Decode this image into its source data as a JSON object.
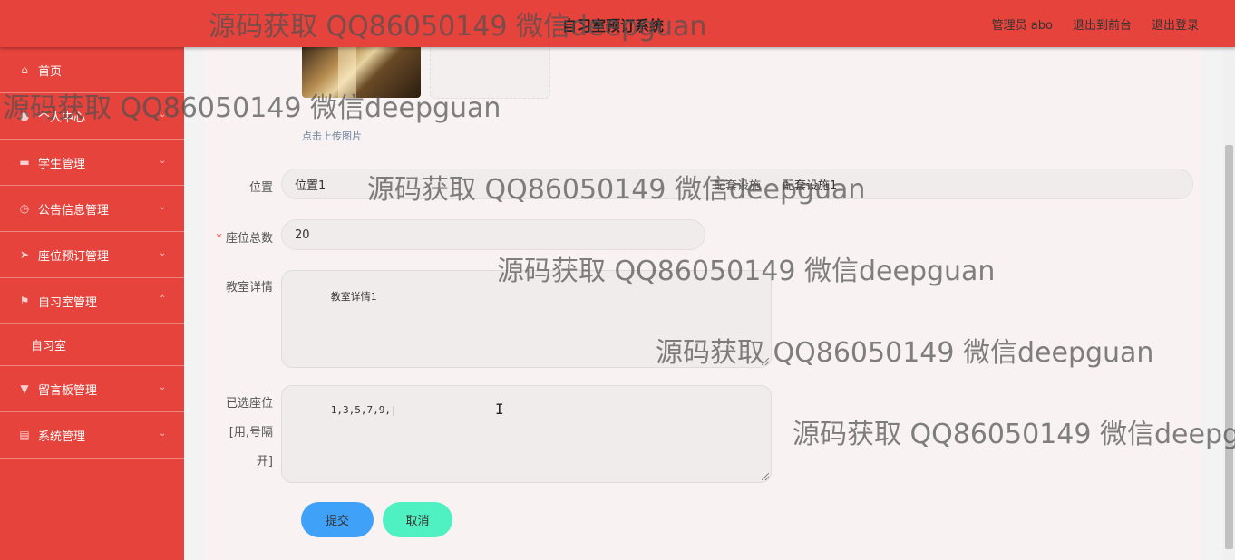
{
  "header": {
    "title": "自习室预订系统",
    "links": [
      "管理员 abo",
      "退出到前台",
      "退出登录"
    ]
  },
  "sidebar": {
    "items": [
      {
        "label": "首页",
        "icon": "home-icon"
      },
      {
        "label": "个人中心",
        "icon": "user-icon"
      },
      {
        "label": "学生管理",
        "icon": "monitor-icon"
      },
      {
        "label": "公告信息管理",
        "icon": "clock-icon"
      },
      {
        "label": "座位预订管理",
        "icon": "send-icon"
      },
      {
        "label": "自习室管理",
        "icon": "flag-icon",
        "sub": [
          "自习室"
        ]
      },
      {
        "label": "留言板管理",
        "icon": "message-icon"
      },
      {
        "label": "系统管理",
        "icon": "briefcase-icon"
      }
    ]
  },
  "form": {
    "upload_hint": "点击上传图片",
    "location_label": "位置",
    "location_value": "位置1",
    "rest_label": "配套设施",
    "rest_value": "配套设施1",
    "seats_label": "座位总数",
    "seats_value": "20",
    "detail_label": "教室详情",
    "detail_value": "教室详情1",
    "selected_label": "已选座位[用,号隔开]",
    "selected_value": "1,3,5,7,9,|",
    "submit": "提交",
    "cancel": "取消"
  },
  "watermark": "源码获取 QQ86050149 微信deepguan",
  "colors": {
    "primary": "#e5433c",
    "submit": "#3fa1f8",
    "cancel": "#4ff1c2"
  }
}
